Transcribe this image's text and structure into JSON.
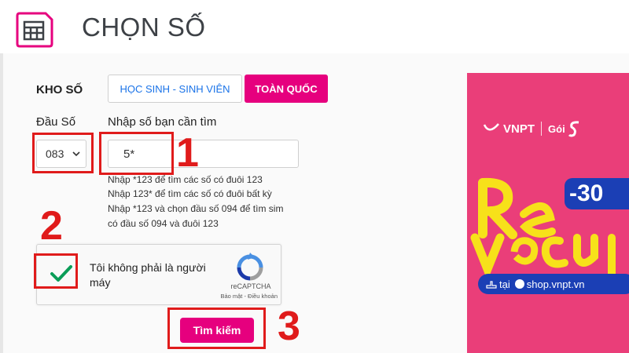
{
  "header": {
    "title": "CHỌN SỐ",
    "icon": "sim-card-icon"
  },
  "number_store": {
    "label": "KHO SỐ",
    "tabs": [
      {
        "label": "HỌC SINH - SINH VIÊN",
        "active": false
      },
      {
        "label": "TOÀN QUỐC",
        "active": true
      }
    ]
  },
  "prefix": {
    "label": "Đầu Số",
    "value": "083"
  },
  "search": {
    "label": "Nhập số bạn cần tìm",
    "value": "5*",
    "hints": [
      "Nhập *123 để tìm các số có đuôi 123",
      "Nhập 123* để tìm các số có đuôi bất kỳ",
      "Nhập *123 và chọn đầu số 094 để tìm sim",
      "có đầu số 094 và đuôi 123"
    ]
  },
  "captcha": {
    "text": "Tôi không phải là người máy",
    "brand": "reCAPTCHA",
    "links": "Bảo mật - Điều khoản",
    "checked": true
  },
  "search_button": {
    "label": "Tìm kiếm"
  },
  "steps": [
    "1",
    "2",
    "3"
  ],
  "ad": {
    "brand": "VNPT",
    "package": "Gói",
    "promo": "-30",
    "shop_prefix": "tại",
    "shop": "shop.vnpt.vn",
    "headline_art": "Rẻ vô cực"
  },
  "colors": {
    "accent": "#e6007e",
    "annotation": "#e01b1b",
    "link": "#1a73e8",
    "ad_bg": "#ea3e79",
    "ad_yellow": "#f7e11a",
    "ad_blue": "#1b3fb5"
  }
}
